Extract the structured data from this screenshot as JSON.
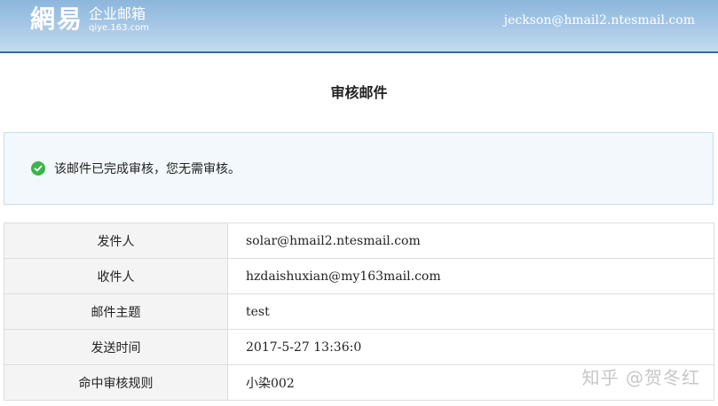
{
  "header": {
    "logo_mark": "網易",
    "logo_title": "企业邮箱",
    "logo_domain": "qiye.163.com",
    "user_email": "jeckson@hmail2.ntesmail.com"
  },
  "page_title": "审核邮件",
  "notice": {
    "icon": "check-circle-icon",
    "icon_color": "#3bb44a",
    "text": "该邮件已完成审核，您无需审核。"
  },
  "details": [
    {
      "label": "发件人",
      "value": "solar@hmail2.ntesmail.com"
    },
    {
      "label": "收件人",
      "value": "hzdaishuxian@my163mail.com"
    },
    {
      "label": "邮件主题",
      "value": "test"
    },
    {
      "label": "发送时间",
      "value": "2017-5-27 13:36:0"
    },
    {
      "label": "命中审核规则",
      "value": "小染002"
    }
  ],
  "watermark": "知乎 @贺冬红",
  "colors": {
    "header_gradient_top": "#8db6dc",
    "header_border": "#2f6da6",
    "notice_bg": "#f2f8fc",
    "label_bg": "#f4f4f4"
  }
}
